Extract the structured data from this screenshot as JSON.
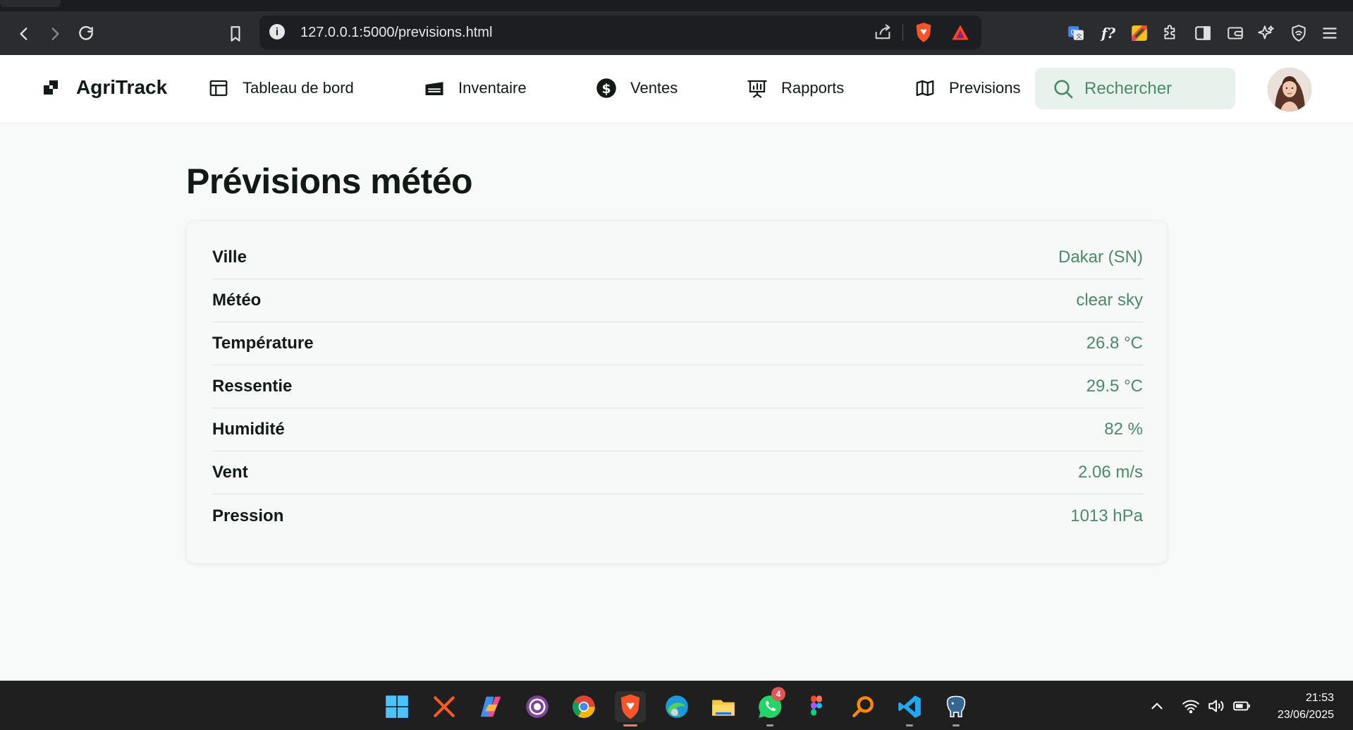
{
  "browser": {
    "url": "127.0.0.1:5000/previsions.html"
  },
  "app": {
    "brand": "AgriTrack",
    "nav": [
      {
        "label": "Tableau de bord",
        "icon": "layout-icon"
      },
      {
        "label": "Inventaire",
        "icon": "warehouse-icon"
      },
      {
        "label": "Ventes",
        "icon": "currency-icon"
      },
      {
        "label": "Rapports",
        "icon": "presentation-chart-icon"
      },
      {
        "label": "Previsions",
        "icon": "map-icon"
      }
    ],
    "search": {
      "placeholder": "Rechercher"
    }
  },
  "main": {
    "title": "Prévisions météo",
    "rows": [
      {
        "label": "Ville",
        "value": "Dakar (SN)"
      },
      {
        "label": "Météo",
        "value": "clear sky"
      },
      {
        "label": "Température",
        "value": "26.8 °C"
      },
      {
        "label": "Ressentie",
        "value": "29.5 °C"
      },
      {
        "label": "Humidité",
        "value": "82 %"
      },
      {
        "label": "Vent",
        "value": "2.06 m/s"
      },
      {
        "label": "Pression",
        "value": "1013 hPa"
      }
    ]
  },
  "taskbar": {
    "whatsapp_badge": "4",
    "time": "21:53",
    "date": "23/06/2025"
  },
  "colors": {
    "accent": "#4b8a66",
    "search_bg": "#e8f2ed",
    "text": "#111a15"
  }
}
